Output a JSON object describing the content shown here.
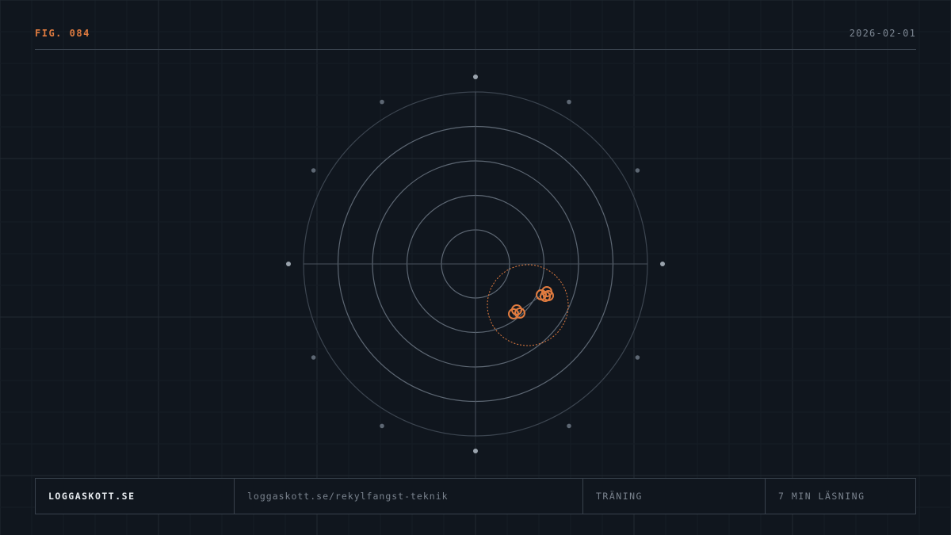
{
  "header": {
    "figure_label": "FIG. 084",
    "date": "2026-02-01"
  },
  "footer": {
    "site": "LOGGASKOTT.SE",
    "url": "loggaskott.se/rekylfangst-teknik",
    "category": "TRÄNING",
    "reading_time": "7 MIN LÄSNING"
  },
  "colors": {
    "background": "#10161e",
    "accent": "#e07b3f",
    "ring": "#5d6773",
    "muted_text": "#7a838e"
  }
}
